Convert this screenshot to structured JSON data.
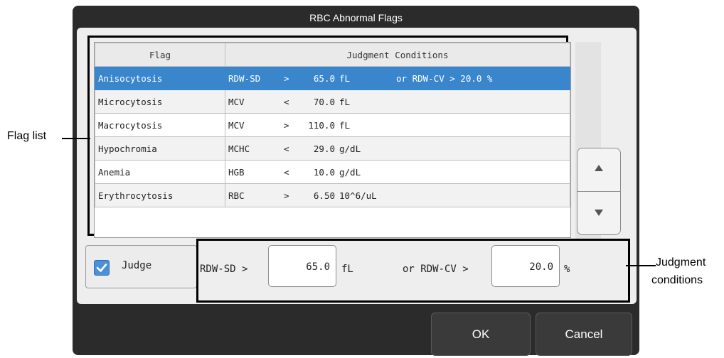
{
  "dialog": {
    "title": "RBC Abnormal Flags"
  },
  "table": {
    "headers": {
      "flag": "Flag",
      "conditions": "Judgment Conditions"
    },
    "rows": [
      {
        "flag": "Anisocytosis",
        "param": "RDW-SD",
        "op": ">",
        "value": "65.0",
        "unit": "fL",
        "extra": "or RDW-CV  >   20.0 %",
        "selected": true
      },
      {
        "flag": "Microcytosis",
        "param": "MCV",
        "op": "<",
        "value": "70.0",
        "unit": "fL",
        "extra": ""
      },
      {
        "flag": "Macrocytosis",
        "param": "MCV",
        "op": ">",
        "value": "110.0",
        "unit": "fL",
        "extra": ""
      },
      {
        "flag": "Hypochromia",
        "param": "MCHC",
        "op": "<",
        "value": "29.0",
        "unit": "g/dL",
        "extra": ""
      },
      {
        "flag": "Anemia",
        "param": "HGB",
        "op": "<",
        "value": "10.0",
        "unit": "g/dL",
        "extra": ""
      },
      {
        "flag": "Erythrocytosis",
        "param": "RBC",
        "op": ">",
        "value": "6.50",
        "unit": "10^6/uL",
        "extra": ""
      }
    ]
  },
  "scroll": {
    "up_icon": "triangle-up-icon",
    "down_icon": "triangle-down-icon"
  },
  "judge": {
    "label": "Judge",
    "checked": true
  },
  "conditions": {
    "param1": "RDW-SD >",
    "value1": "65.0",
    "unit1": "fL",
    "param2": "or RDW-CV >",
    "value2": "20.0",
    "unit2": "%"
  },
  "buttons": {
    "ok": "OK",
    "cancel": "Cancel"
  },
  "callouts": {
    "flag_list": "Flag list",
    "judgment_conditions_1": "Judgment",
    "judgment_conditions_2": "conditions"
  },
  "colors": {
    "selected": "#3a86cc",
    "dialog_bg": "#2b2b2b",
    "panel_bg": "#eeeeee"
  }
}
